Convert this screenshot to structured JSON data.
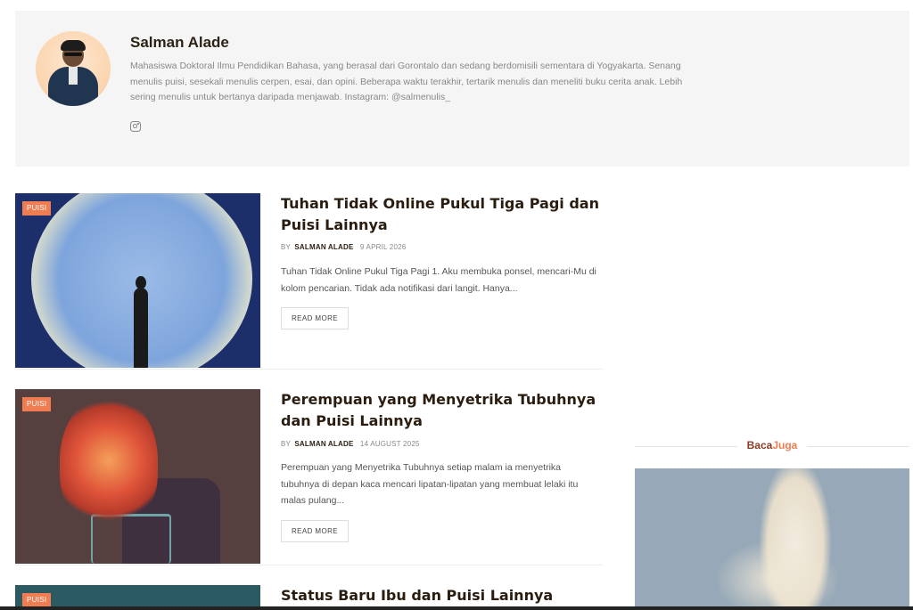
{
  "author": {
    "name": "Salman Alade",
    "bio": "Mahasiswa Doktoral Ilmu Pendidikan Bahasa, yang berasal dari Gorontalo dan sedang berdomisili sementara di Yogyakarta. Senang menulis puisi, sesekali menulis cerpen, esai, dan opini. Beberapa waktu terakhir, tertarik menulis dan meneliti buku cerita anak. Lebih sering menulis untuk bertanya daripada menjawab. Instagram: @salmenulis_",
    "social_icon": "instagram-icon"
  },
  "posts": [
    {
      "category": "PUISI",
      "title": "Tuhan Tidak Online Pukul Tiga Pagi dan Puisi Lainnya",
      "by": "BY",
      "author": "SALMAN ALADE",
      "date": "9 APRIL 2026",
      "excerpt": "Tuhan Tidak Online Pukul Tiga Pagi 1. Aku membuka ponsel, mencari-Mu di kolom pencarian. Tidak ada notifikasi dari langit. Hanya...",
      "read_more": "READ MORE"
    },
    {
      "category": "PUISI",
      "title": "Perempuan yang Menyetrika Tubuhnya dan Puisi Lainnya",
      "by": "BY",
      "author": "SALMAN ALADE",
      "date": "14 AUGUST 2025",
      "excerpt": "Perempuan yang Menyetrika Tubuhnya setiap malam ia menyetrika tubuhnya di depan kaca mencari lipatan-lipatan yang membuat lelaki itu malas pulang...",
      "read_more": "READ MORE"
    },
    {
      "category": "PUISI",
      "title": "Status Baru Ibu dan Puisi Lainnya"
    }
  ],
  "sidebar": {
    "title_part1": "Baca",
    "title_part2": "Juga"
  }
}
